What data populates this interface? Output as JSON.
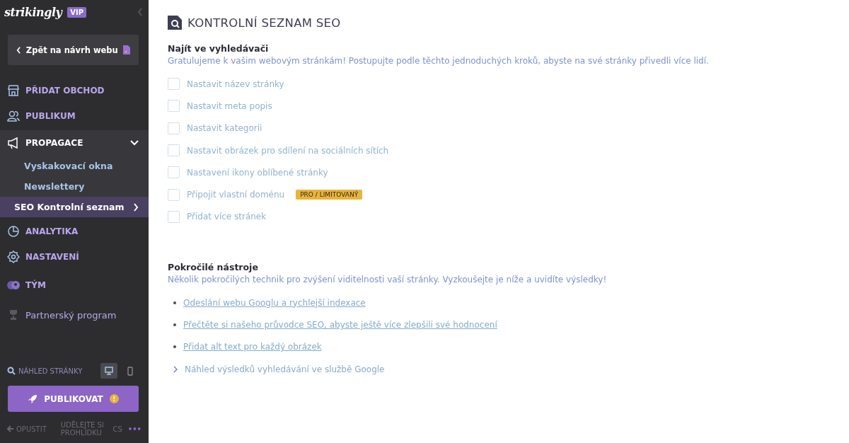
{
  "brand": {
    "logo": "strikingly",
    "badge": "VIP"
  },
  "back_button": {
    "label": "Zpět na návrh webu"
  },
  "nav": [
    {
      "label": "PŘIDAT OBCHOD",
      "kind": "main",
      "expanded": false
    },
    {
      "label": "PUBLIKUM",
      "kind": "main",
      "expanded": false
    },
    {
      "label": "PROPAGACE",
      "kind": "main",
      "expanded": true,
      "children": [
        {
          "label": "Vyskakovací okna",
          "selected": false
        },
        {
          "label": "Newslettery",
          "selected": false
        },
        {
          "label": "SEO Kontrolní seznam",
          "selected": true
        }
      ]
    },
    {
      "label": "ANALYTIKA",
      "kind": "main",
      "expanded": false
    },
    {
      "label": "NASTAVENÍ",
      "kind": "main",
      "expanded": false
    },
    {
      "label": "TÝM",
      "kind": "main",
      "expanded": false
    },
    {
      "label": "Partnerský program",
      "kind": "plain",
      "expanded": false
    }
  ],
  "preview": {
    "label": "NÁHLED STRÁNKY",
    "devices": [
      {
        "kind": "desktop",
        "selected": true
      },
      {
        "kind": "mobile",
        "selected": false
      }
    ]
  },
  "publish": {
    "label": "PUBLIKOVAT",
    "badge": "!"
  },
  "footer": {
    "exit": "OPUSTIT",
    "tour": "UDĚLEJTE SI PROHLÍDKU",
    "language": "CS",
    "more": "•••"
  },
  "main": {
    "title": "KONTROLNÍ SEZNAM SEO",
    "search_section": {
      "heading": "Najít ve vyhledávači",
      "intro": "Gratulujeme k vašim webovým stránkám! Postupujte podle těchto jednoduchých kroků, abyste na své stránky přivedli více lidí.",
      "items": [
        {
          "label": "Nastavit název stránky",
          "checked": false
        },
        {
          "label": "Nastavit meta popis",
          "checked": false
        },
        {
          "label": "Nastavit kategorii",
          "checked": false
        },
        {
          "label": "Nastavit obrázek pro sdílení na sociálních sítích",
          "checked": false
        },
        {
          "label": "Nastavení ikony oblíbené stránky",
          "checked": false
        },
        {
          "label": "Připojit vlastní doménu",
          "checked": false,
          "badge": "PRO / LIMITOVANÝ"
        },
        {
          "label": "Přidat více stránek",
          "checked": false
        }
      ]
    },
    "advanced_section": {
      "heading": "Pokročilé nástroje",
      "intro": "Několik pokročilých technik pro zvýšení viditelnosti vaší stránky. Vyzkoušejte je níže a uvidíte výsledky!",
      "links": [
        {
          "label": "Odeslání webu Googlu a rychlejší indexace",
          "kind": "link"
        },
        {
          "label": "Přečtěte si našeho průvodce SEO, abyste ještě více zlepšili své hodnocení",
          "kind": "link"
        },
        {
          "label": "Přidat alt text pro každý obrázek",
          "kind": "link"
        },
        {
          "label": "Náhled výsledků vyhledávání ve službě Google",
          "kind": "expand"
        }
      ]
    }
  }
}
